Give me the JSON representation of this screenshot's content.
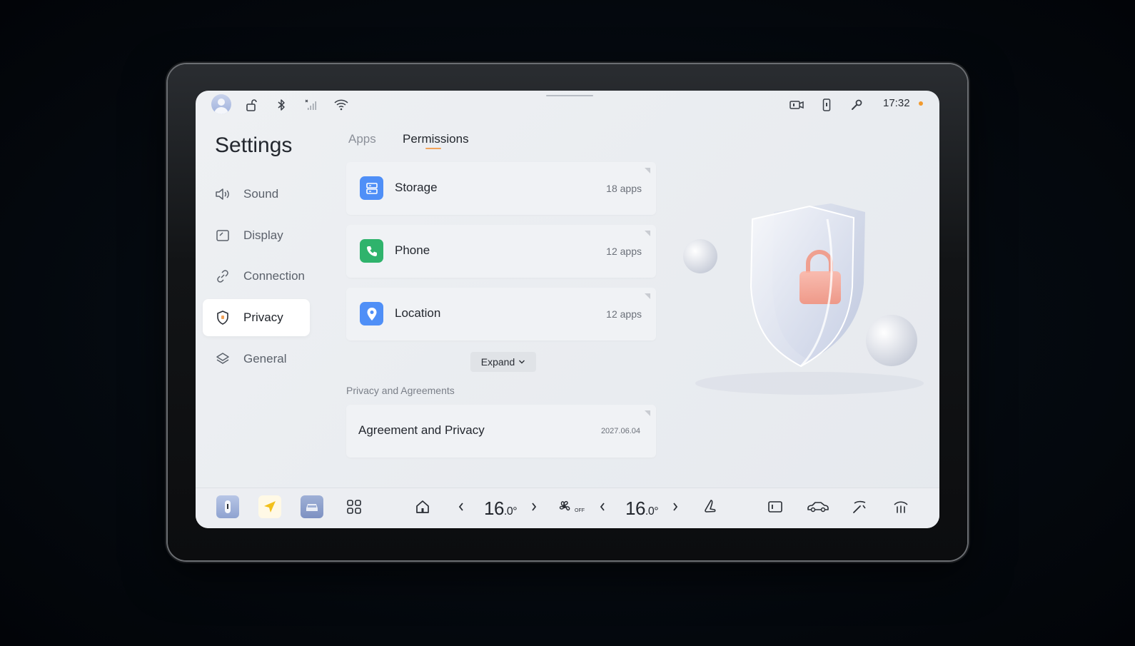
{
  "status_bar": {
    "time": "17:32",
    "icons": [
      "avatar",
      "unlock-icon",
      "bluetooth-icon",
      "signal-icon",
      "wifi-icon",
      "dashcam-icon",
      "phone-key-icon",
      "wrench-icon"
    ],
    "accent_dot_color": "#f29a2e"
  },
  "sidebar": {
    "title": "Settings",
    "items": [
      {
        "label": "Sound",
        "icon": "speaker-icon"
      },
      {
        "label": "Display",
        "icon": "display-icon"
      },
      {
        "label": "Connection",
        "icon": "link-icon"
      },
      {
        "label": "Privacy",
        "icon": "shield-icon",
        "active": true
      },
      {
        "label": "General",
        "icon": "layers-icon"
      }
    ]
  },
  "tabs": [
    {
      "label": "Apps"
    },
    {
      "label": "Permissions",
      "active": true
    }
  ],
  "permissions": [
    {
      "name": "Storage",
      "count": "18 apps",
      "icon": "storage-icon",
      "color": "#4f8ff7"
    },
    {
      "name": "Phone",
      "count": "12 apps",
      "icon": "phone-icon",
      "color": "#2fb36c"
    },
    {
      "name": "Location",
      "count": "12 apps",
      "icon": "location-icon",
      "color": "#4f8ff7"
    }
  ],
  "expand_label": "Expand",
  "agreements": {
    "section_title": "Privacy and Agreements",
    "item_name": "Agreement and Privacy",
    "item_date": "2027.06.04"
  },
  "dock": {
    "left_temp": {
      "main": "16",
      "decimal": ".0",
      "unit": "°"
    },
    "right_temp": {
      "main": "16",
      "decimal": ".0",
      "unit": "°"
    },
    "fan_label": "OFF",
    "icons": [
      "car-key-app-icon",
      "navigation-app-icon",
      "car-app-icon",
      "apps-grid-icon",
      "home-icon",
      "chevron-left-icon",
      "chevron-right-icon",
      "fan-icon",
      "seat-icon",
      "rear-screen-icon",
      "car-side-icon",
      "wiper-icon",
      "defrost-icon"
    ]
  }
}
